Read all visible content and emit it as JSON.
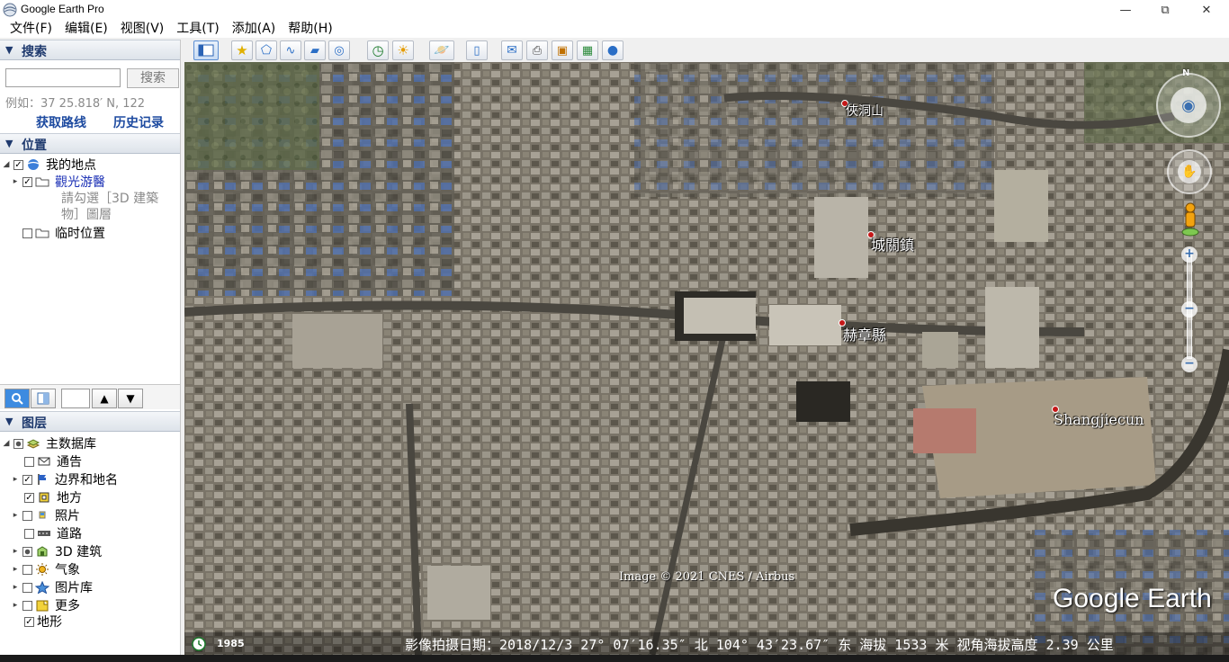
{
  "window": {
    "title": "Google Earth Pro"
  },
  "menu": [
    "文件(F)",
    "编辑(E)",
    "视图(V)",
    "工具(T)",
    "添加(A)",
    "帮助(H)"
  ],
  "search": {
    "header": "搜索",
    "button": "搜索",
    "placeholder": "",
    "example": "例如：37 25.818′ N, 122",
    "get_route": "获取路线",
    "history": "历史记录"
  },
  "places": {
    "header": "位置",
    "items": [
      {
        "label": "我的地点",
        "checked": true
      },
      {
        "label": "觀光游醫",
        "checked": true
      },
      {
        "label": "請勾選［3D 建築",
        "note": true
      },
      {
        "label": "物］圖層",
        "note": true
      },
      {
        "label": "临时位置",
        "checked": false
      }
    ]
  },
  "layers": {
    "header": "图层",
    "items": [
      {
        "label": "主数据库",
        "icon": "database-icon"
      },
      {
        "label": "通告",
        "icon": "envelope-icon"
      },
      {
        "label": "边界和地名",
        "icon": "flag-icon"
      },
      {
        "label": "地方",
        "icon": "place-square-icon"
      },
      {
        "label": "照片",
        "icon": "photo-icon"
      },
      {
        "label": "道路",
        "icon": "road-icon"
      },
      {
        "label": "3D 建筑",
        "icon": "building-icon"
      },
      {
        "label": "气象",
        "icon": "weather-sun-icon"
      },
      {
        "label": "图片库",
        "icon": "gallery-star-icon"
      },
      {
        "label": "更多",
        "icon": "more-folder-icon"
      },
      {
        "label": "地形",
        "icon": ""
      }
    ]
  },
  "map": {
    "labels": [
      {
        "text": "俠洞山"
      },
      {
        "text": "城關鎮"
      },
      {
        "text": "赫章縣"
      },
      {
        "text": "Shangjiecun"
      }
    ],
    "attribution": "Image © 2021 CNES / Airbus",
    "logo": "Google Earth",
    "compass_north": "N",
    "historical_year": "1985",
    "status": "影像拍摄日期：2018/12/3   27° 07′16.35″ 北 104° 43′23.67″ 东 海拔  1533 米   视角海拔高度   2.39 公里"
  }
}
